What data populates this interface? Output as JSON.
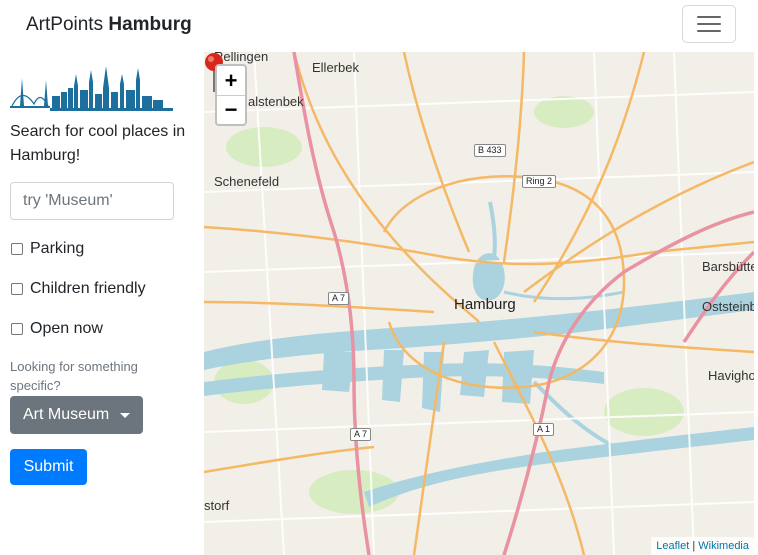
{
  "navbar": {
    "brand_prefix": "ArtPoints",
    "brand_bold": "Hamburg"
  },
  "sidebar": {
    "search_text": "Search for cool places in Hamburg!",
    "search_placeholder": "try 'Museum'",
    "search_value": "",
    "filters": [
      {
        "label": "Parking",
        "checked": false
      },
      {
        "label": "Children friendly",
        "checked": false
      },
      {
        "label": "Open now",
        "checked": false
      }
    ],
    "specific_label": "Looking for something specific?",
    "category_selected": "Art Museum",
    "submit_label": "Submit"
  },
  "map": {
    "zoom_in": "+",
    "zoom_out": "−",
    "places": {
      "rellingen": "Rellingen",
      "ellerbek": "Ellerbek",
      "halstenbek": "alstenbek",
      "schenefeld": "Schenefeld",
      "hamburg": "Hamburg",
      "barsbuettel": "Barsbütte",
      "oststeinbek": "Oststeinb",
      "havighorst": "Havigho",
      "storf": "storf"
    },
    "shields": {
      "b433": "B 433",
      "ring2": "Ring 2",
      "a7_north": "A 7",
      "a7_south": "A 7",
      "a1": "A 1"
    },
    "attribution_leaflet": "Leaflet",
    "attribution_sep": "|",
    "attribution_wikimedia": "Wikimedia",
    "colors": {
      "land": "#f2efe9",
      "water": "#aad3df",
      "motorway": "#e892a2",
      "primary": "#fcd6a4",
      "marker": "#d6291b"
    }
  }
}
